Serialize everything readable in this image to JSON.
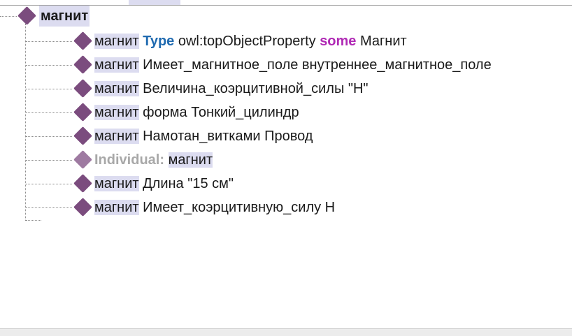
{
  "root": {
    "label": "магнит"
  },
  "items": [
    {
      "subject": "магнит",
      "parts": [
        {
          "text": "Type",
          "style": "type"
        },
        {
          "text": " owl:topObjectProperty ",
          "style": "plain"
        },
        {
          "text": "some",
          "style": "some"
        },
        {
          "text": " Магнит",
          "style": "plain"
        }
      ]
    },
    {
      "subject": "магнит",
      "rest": "Имеет_магнитное_поле внутреннее_магнитное_поле"
    },
    {
      "subject": "магнит",
      "rest": "Величина_коэрцитивной_силы \"H\""
    },
    {
      "subject": "магнит",
      "rest": "форма Тонкий_цилиндр"
    },
    {
      "subject": "магнит",
      "rest": "Намотан_витками Провод"
    },
    {
      "keyword": "Individual:",
      "subject": "магнит"
    },
    {
      "subject": "магнит",
      "rest": "Длина \"15 см\""
    },
    {
      "subject": "магнит",
      "rest": "Имеет_коэрцитивную_силу H"
    }
  ],
  "colors": {
    "diamond": "#7b4c7e",
    "highlight": "#dcdcf0",
    "type_keyword": "#1f6ab0",
    "some_keyword": "#b02ab5",
    "individual_keyword": "#a8a8a8"
  }
}
